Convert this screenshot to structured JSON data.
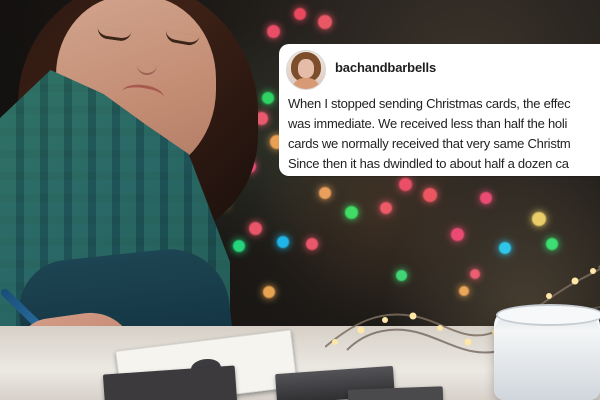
{
  "post": {
    "username": "bachandbarbells",
    "lines": [
      "When I stopped sending Christmas cards, the effec",
      "was immediate. We received less than half the holi",
      "cards we normally received that very same Christm",
      "Since then it has dwindled to about half a dozen ca"
    ]
  },
  "scene": {
    "accent_colors": {
      "overlay_background": "#ffffff",
      "text_primary": "#222222",
      "shirt_teal": "#2c5f56",
      "shirt_blue": "#1c4659",
      "table": "#ece9e3"
    },
    "icons": {
      "avatar": "profile-photo",
      "pen": "pen-icon"
    }
  }
}
